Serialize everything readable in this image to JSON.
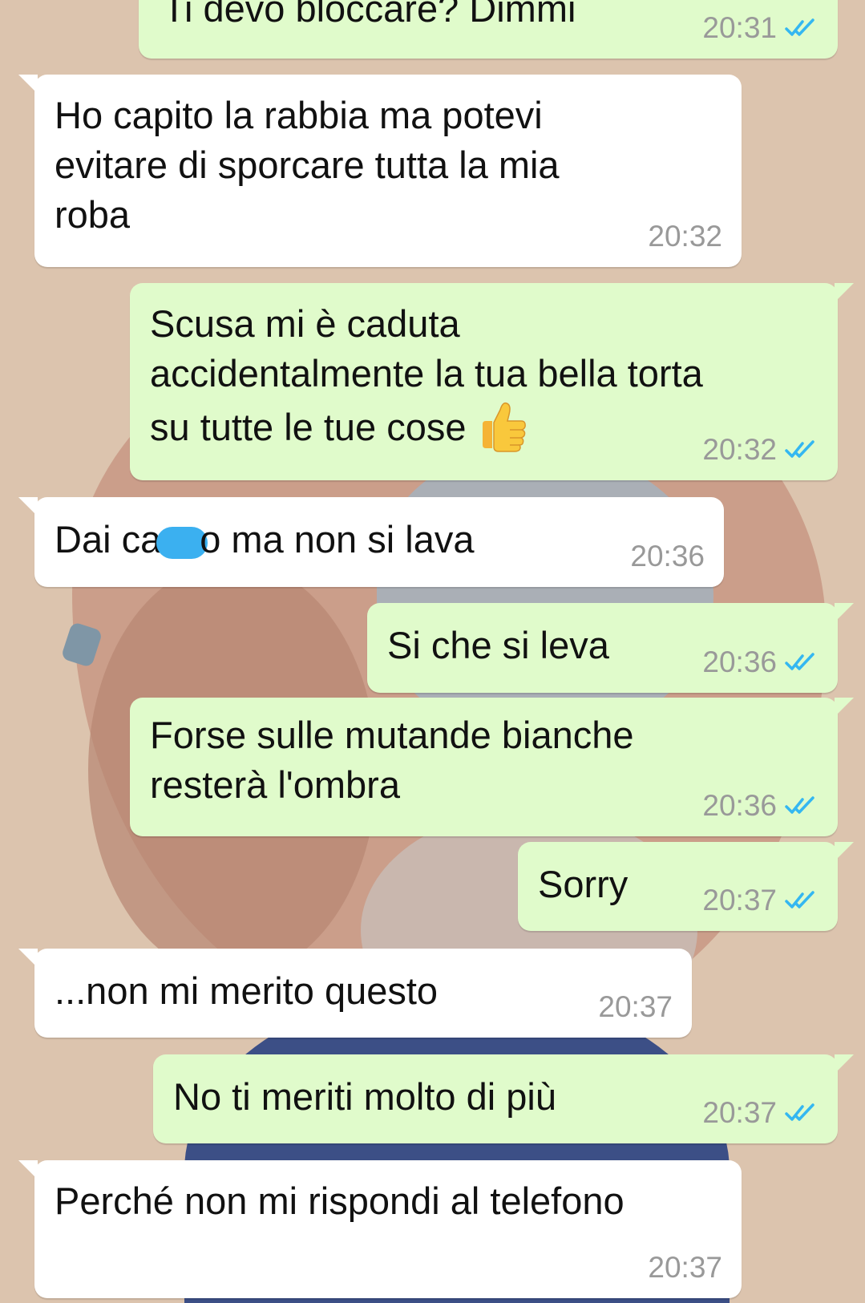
{
  "conversation": {
    "messages": [
      {
        "direction": "outgoing",
        "text": "Ti devo bloccare? Dimmi",
        "time": "20:31",
        "read": true
      },
      {
        "direction": "incoming",
        "lines": [
          "Ho capito la rabbia ma potevi",
          "evitare di sporcare tutta la mia",
          "roba"
        ],
        "time": "20:32"
      },
      {
        "direction": "outgoing",
        "lines": [
          "Scusa mi è caduta",
          "accidentalmente la tua bella torta",
          "su tutte le tue cose"
        ],
        "emoji": "thumbs-up-emoji",
        "time": "20:32",
        "read": true
      },
      {
        "direction": "incoming",
        "text_before": "Dai ca",
        "text_after": "o ma non si lava",
        "censored": true,
        "censor_color": "#3bb0f0",
        "time": "20:36"
      },
      {
        "direction": "outgoing",
        "text": "Si che si leva",
        "time": "20:36",
        "read": true
      },
      {
        "direction": "outgoing",
        "lines": [
          "Forse sulle mutande bianche",
          "resterà l'ombra"
        ],
        "time": "20:36",
        "read": true
      },
      {
        "direction": "outgoing",
        "text": "Sorry",
        "time": "20:37",
        "read": true
      },
      {
        "direction": "incoming",
        "text": "...non mi merito questo",
        "time": "20:37"
      },
      {
        "direction": "outgoing",
        "text": "No ti meriti molto di più",
        "time": "20:37",
        "read": true
      },
      {
        "direction": "incoming",
        "text": "Perché non mi rispondi al telefono",
        "time": "20:37"
      }
    ]
  },
  "colors": {
    "incoming_bubble": "#ffffff",
    "outgoing_bubble": "#e0fbcb",
    "read_ticks": "#34b7f1",
    "timestamp": "#999999",
    "wallpaper": "#dcc4ae"
  }
}
